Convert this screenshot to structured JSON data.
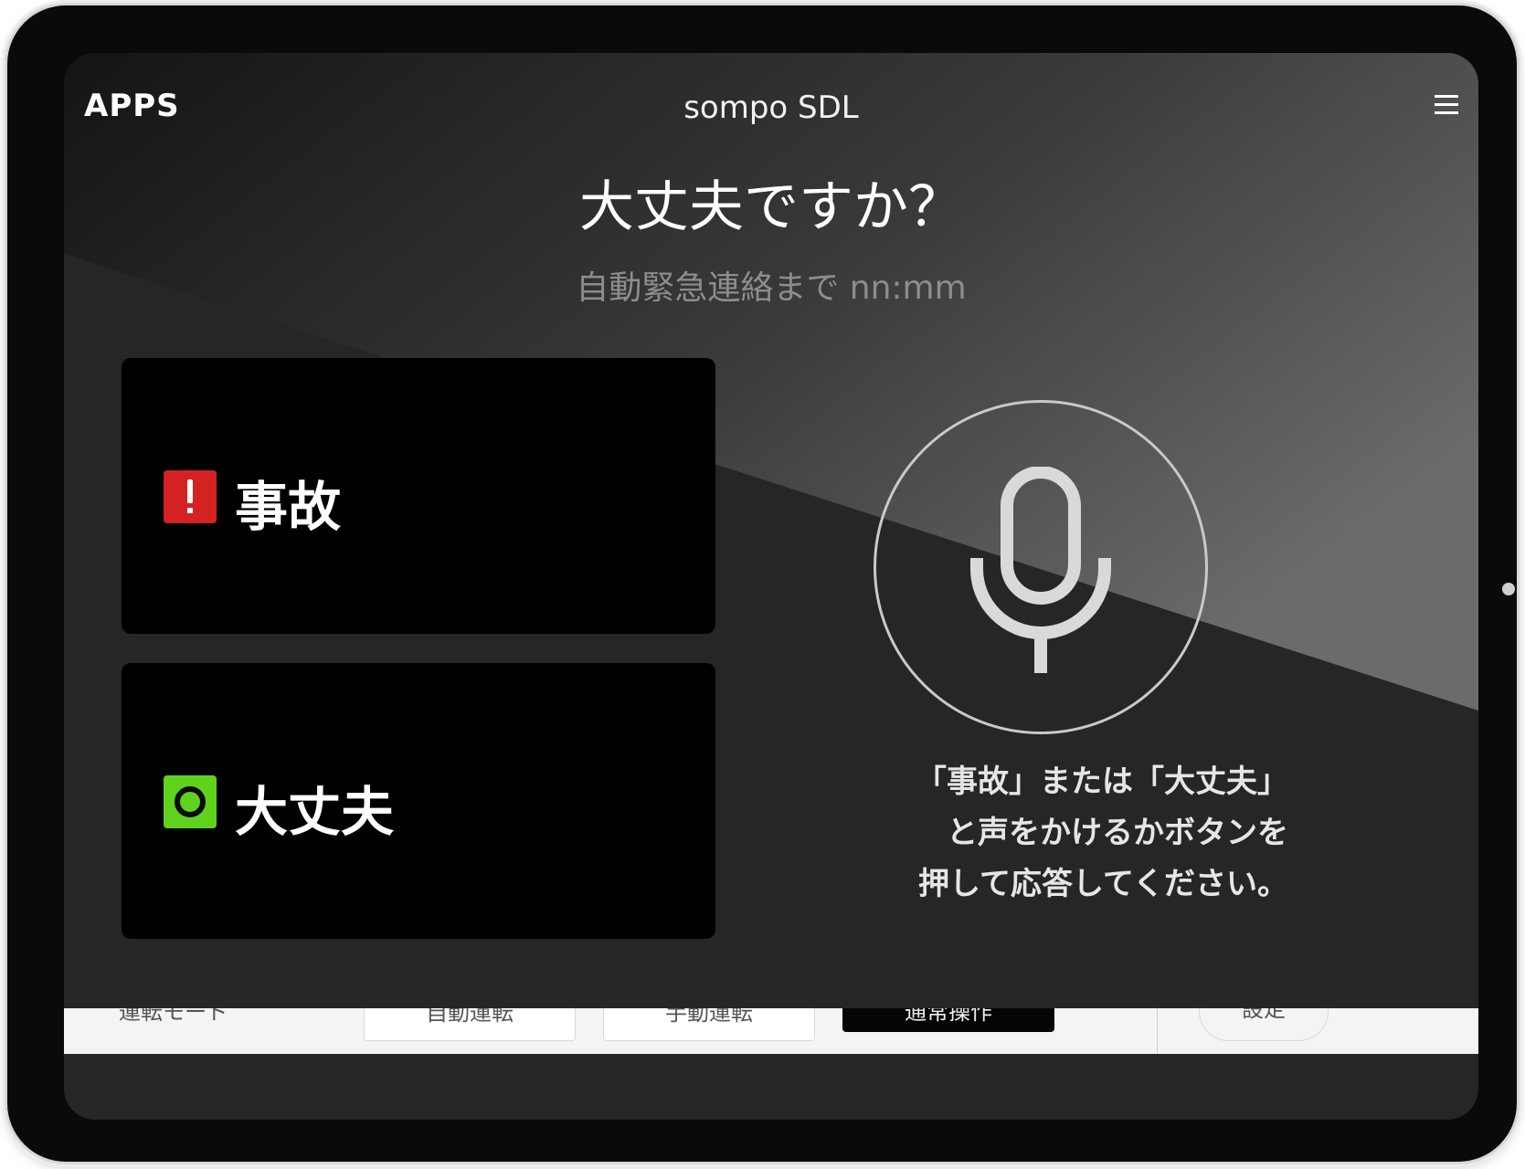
{
  "header": {
    "apps_label": "APPS",
    "app_title": "sompo SDL",
    "menu_icon": "hamburger-menu-icon"
  },
  "prompt": {
    "question": "大丈夫ですか？",
    "countdown": "自動緊急連絡まで nn:mm"
  },
  "buttons": {
    "accident": {
      "label": "事故",
      "icon": "warning-icon",
      "icon_color": "#d42222"
    },
    "ok": {
      "label": "大丈夫",
      "icon": "ok-circle-icon",
      "icon_color": "#5fd31b"
    }
  },
  "voice": {
    "icon": "microphone-icon",
    "instruction_lines": [
      "「事故」または「大丈夫」",
      "と声をかけるかボタンを",
      "押して応答してください。"
    ]
  },
  "bottom_bar": {
    "items": [
      "運転モード",
      "自動運転",
      "手動運転",
      "通常操作",
      "設定"
    ]
  }
}
